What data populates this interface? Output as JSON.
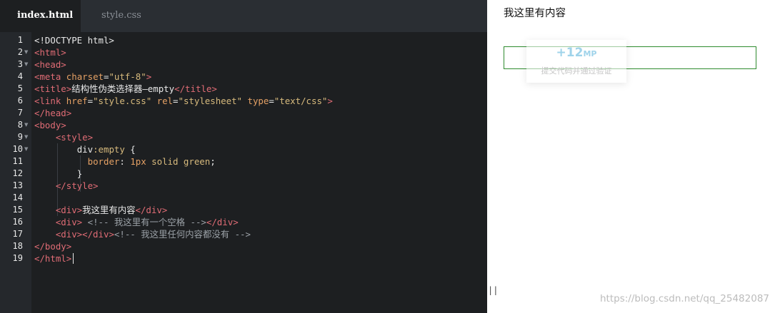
{
  "tabs": [
    {
      "label": "index.html",
      "active": true
    },
    {
      "label": "style.css",
      "active": false
    }
  ],
  "code": {
    "line_numbers": [
      "1",
      "2",
      "3",
      "4",
      "5",
      "6",
      "7",
      "8",
      "9",
      "10",
      "11",
      "12",
      "13",
      "14",
      "15",
      "16",
      "17",
      "18",
      "19"
    ],
    "l1": "<!DOCTYPE html>",
    "l2": "<html>",
    "l3": "<head>",
    "l4": {
      "open": "<meta",
      "attr": "charset",
      "eq": "=",
      "val": "\"utf-8\"",
      "close": ">"
    },
    "l5": {
      "open": "<title>",
      "text": "结构性伪类选择器—empty",
      "close": "</title>"
    },
    "l6": {
      "open": "<link",
      "a1": "href",
      "v1": "\"style.css\"",
      "a2": "rel",
      "v2": "\"stylesheet\"",
      "a3": "type",
      "v3": "\"text/css\"",
      "close": ">"
    },
    "l7": "</head>",
    "l8": "<body>",
    "l9": "<style>",
    "l10": {
      "sel": "div",
      "pseudo": ":empty",
      "brace": " {"
    },
    "l11": {
      "prop": "border",
      "colon": ": ",
      "num": "1px",
      "val": " solid green",
      "semi": ";"
    },
    "l12": "}",
    "l13": "</style>",
    "l15": {
      "open": "<div>",
      "text": "我这里有内容",
      "close": "</div>"
    },
    "l16": {
      "open": "<div>",
      "comment": " <!-- 我这里有一个空格 -->",
      "close": "</div>"
    },
    "l17": {
      "open": "<div></div>",
      "comment": "<!-- 我这里任何内容都没有 -->"
    },
    "l18": "</body>",
    "l19": "</html>"
  },
  "preview": {
    "content_text": "我这里有内容",
    "toast_score": "+12",
    "toast_unit": "MP",
    "toast_sub": "提交代码并通过验证",
    "handle": "||",
    "watermark": "https://blog.csdn.net/qq_25482087"
  },
  "colors": {
    "editor_bg": "#1d1f21",
    "tag": "#e06c75",
    "attr": "#e5a165",
    "string": "#d7ba7d",
    "border_green": "#2e8b2e"
  }
}
